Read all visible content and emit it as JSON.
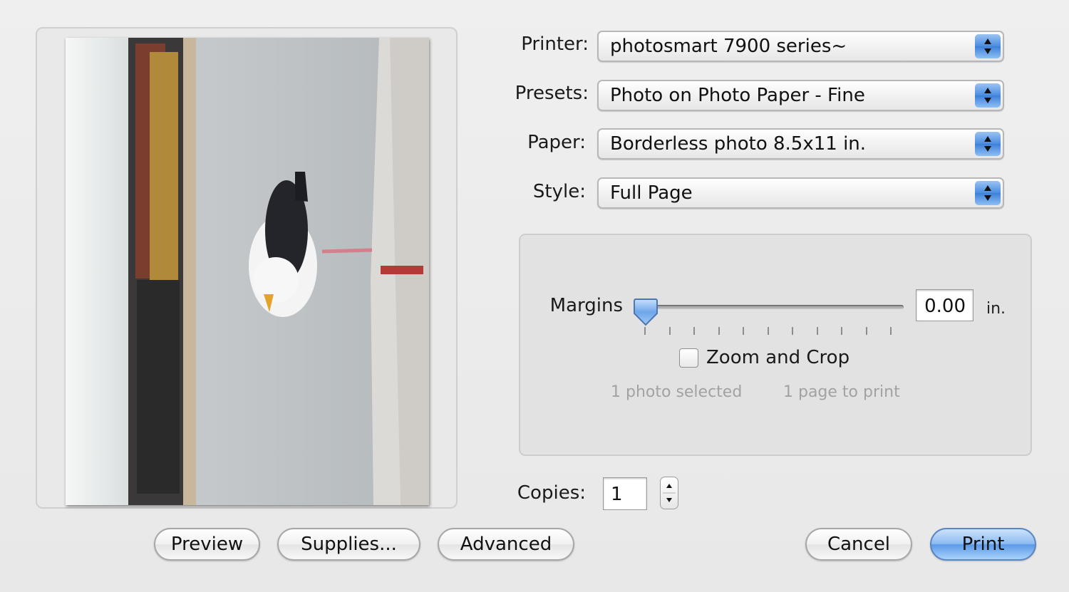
{
  "form": {
    "printer": {
      "label": "Printer:",
      "value": "photosmart 7900 series~"
    },
    "presets": {
      "label": "Presets:",
      "value": "Photo on Photo Paper - Fine"
    },
    "paper": {
      "label": "Paper:",
      "value": "Borderless photo 8.5x11 in."
    },
    "style": {
      "label": "Style:",
      "value": "Full Page"
    }
  },
  "layout_box": {
    "margins_label": "Margins",
    "margins_value": "0.00",
    "margins_unit": "in.",
    "margins_slider_fraction": 0.0,
    "zoom_crop_label": "Zoom and Crop",
    "zoom_crop_checked": false,
    "photos_selected": "1 photo selected",
    "pages_to_print": "1 page to print"
  },
  "copies": {
    "label": "Copies:",
    "value": "1"
  },
  "buttons": {
    "preview": "Preview",
    "supplies": "Supplies...",
    "advanced": "Advanced",
    "cancel": "Cancel",
    "print": "Print"
  },
  "colors": {
    "accent": "#4a8ce0",
    "default_button": "#5b9ae7"
  }
}
